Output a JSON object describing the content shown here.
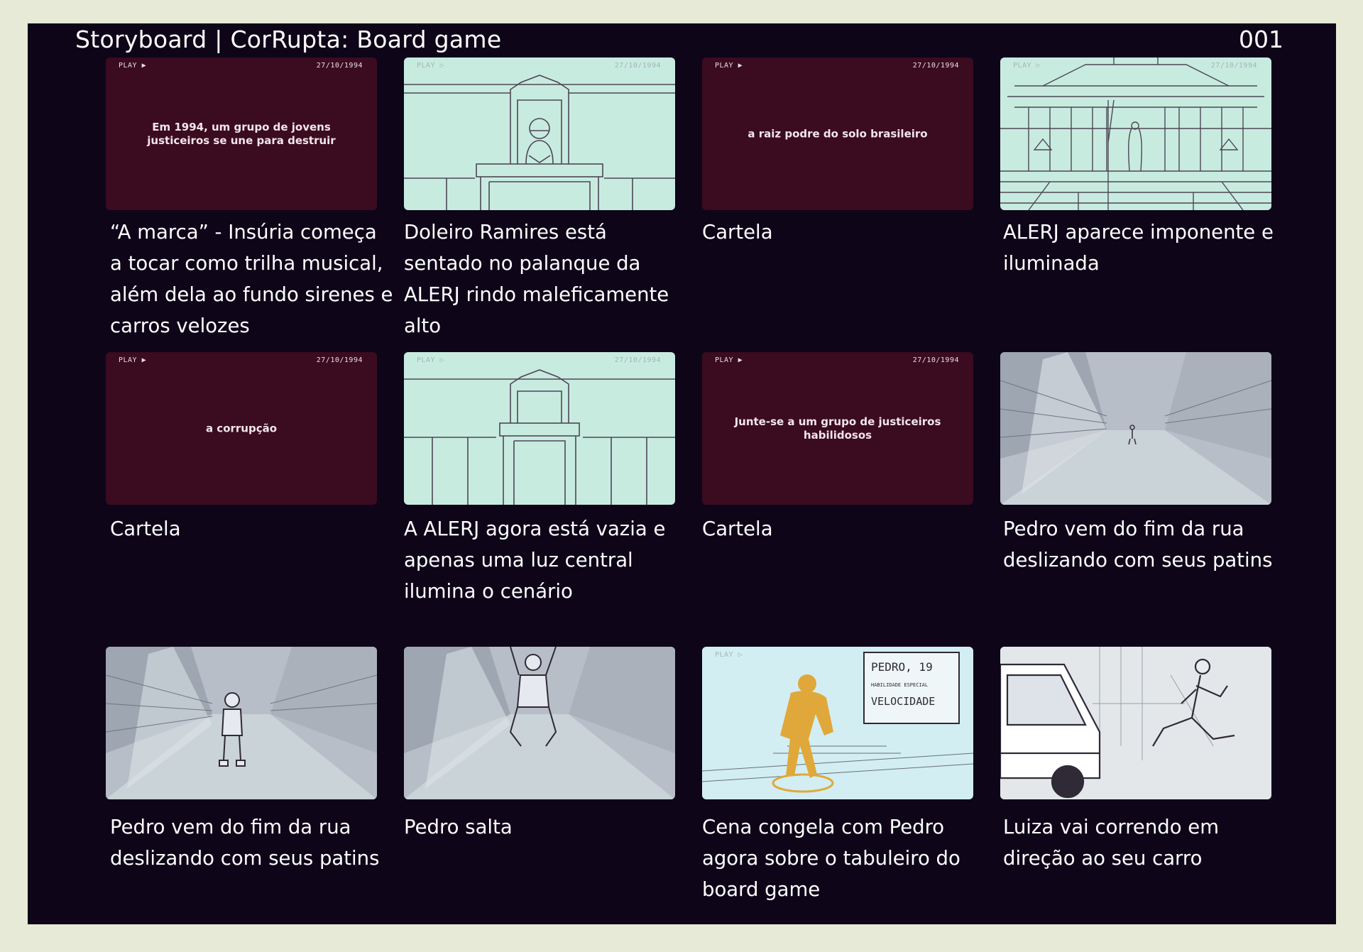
{
  "header": {
    "title": "Storyboard | CorRupta: Board game",
    "page_number": "001"
  },
  "osd": {
    "play": "PLAY ▶",
    "play_outline": "PLAY ▷",
    "date_1": "27/10/1994",
    "date_2": "27/10/1994"
  },
  "panels": [
    {
      "kind": "card",
      "card_text": "Em 1994, um grupo de jovens justiceiros se une para destruir",
      "caption": "“A marca” - Insúria começa a tocar como trilha musical, além dela ao fundo sirenes e carros velozes"
    },
    {
      "kind": "sketch",
      "card_text": "",
      "caption": "Doleiro Ramires está sentado no palanque da ALERJ rindo maleficamente alto"
    },
    {
      "kind": "card",
      "card_text": "a raiz podre do solo brasileiro",
      "caption": "Cartela"
    },
    {
      "kind": "sketch",
      "card_text": "",
      "caption": "ALERJ aparece imponente e iluminada"
    },
    {
      "kind": "card",
      "card_text": "a corrupção",
      "caption": "Cartela"
    },
    {
      "kind": "sketch",
      "card_text": "",
      "caption": "A ALERJ agora está vazia e apenas uma luz central ilumina o cenário"
    },
    {
      "kind": "card",
      "card_text": "Junte-se a um grupo de justiceiros habilidosos",
      "caption": "Cartela"
    },
    {
      "kind": "street",
      "card_text": "",
      "caption": "Pedro vem do fim da rua deslizando com seus patins"
    },
    {
      "kind": "street",
      "card_text": "",
      "caption": "Pedro vem do fim da rua deslizando com seus patins"
    },
    {
      "kind": "street",
      "card_text": "",
      "caption": "Pedro salta"
    },
    {
      "kind": "light",
      "card_text": "",
      "caption": "Cena congela com Pedro agora sobre o tabuleiro do board game"
    },
    {
      "kind": "light",
      "card_text": "",
      "caption": "Luiza vai correndo em direção ao seu carro"
    }
  ],
  "sign": {
    "line1": "PEDRO, 19",
    "line2": "HABILIDADE ESPECIAL",
    "line3": "VELOCIDADE"
  },
  "colors": {
    "card": "#3b0b1f",
    "sketch": "#c8ebe0",
    "street": "#b8bec8",
    "figure": "#e0a83a",
    "board": "#0e0519",
    "frame": "#e6ead6"
  }
}
